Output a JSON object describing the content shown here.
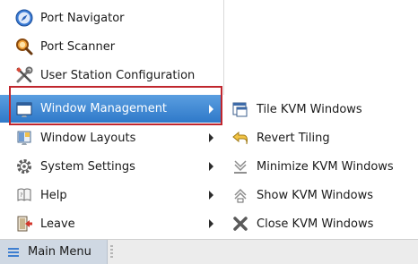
{
  "main_menu": {
    "items": [
      {
        "label": "Port Navigator",
        "icon": "compass-icon",
        "submenu": false
      },
      {
        "label": "Port Scanner",
        "icon": "magnifier-icon",
        "submenu": false
      },
      {
        "label": "User Station Configuration",
        "icon": "tools-icon",
        "submenu": false
      },
      {
        "label": "Window Management",
        "icon": "window-icon",
        "submenu": true,
        "active": true
      },
      {
        "label": "Window Layouts",
        "icon": "layout-icon",
        "submenu": true
      },
      {
        "label": "System Settings",
        "icon": "gear-icon",
        "submenu": true
      },
      {
        "label": "Help",
        "icon": "help-icon",
        "submenu": true
      },
      {
        "label": "Leave",
        "icon": "exit-icon",
        "submenu": true
      }
    ]
  },
  "window_management_submenu": {
    "items": [
      {
        "label": "Tile KVM Windows",
        "icon": "tile-icon"
      },
      {
        "label": "Revert Tiling",
        "icon": "revert-arrow-icon"
      },
      {
        "label": "Minimize KVM Windows",
        "icon": "minimize-icon"
      },
      {
        "label": "Show KVM Windows",
        "icon": "show-icon"
      },
      {
        "label": "Close KVM Windows",
        "icon": "close-icon"
      }
    ]
  },
  "taskbar": {
    "start_label": "Main Menu",
    "start_icon": "hamburger-icon"
  },
  "colors": {
    "highlight": "#3a84d4",
    "callout": "#c0262d"
  }
}
